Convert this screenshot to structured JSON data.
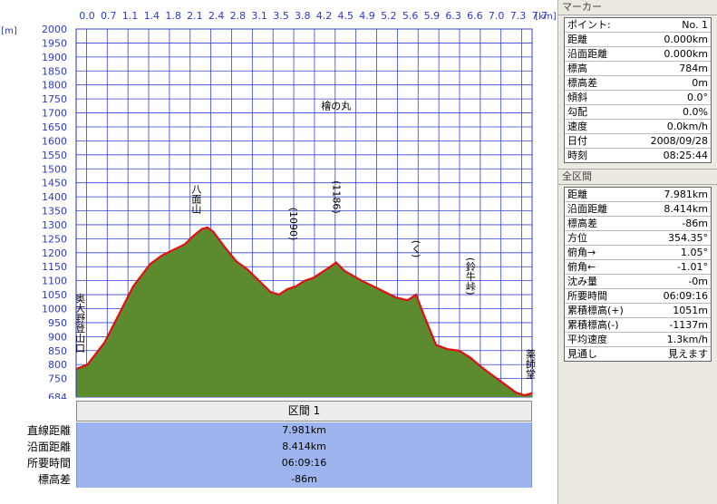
{
  "chart_data": {
    "type": "area",
    "title": "",
    "xlabel": "[km]",
    "ylabel": "[m]",
    "xlim": [
      0,
      7.981
    ],
    "ylim": [
      684,
      2000
    ],
    "x_ticks": [
      "0.0",
      "0.7",
      "1.1",
      "1.4",
      "1.8",
      "2.1",
      "2.4",
      "2.8",
      "3.1",
      "3.5",
      "3.8",
      "4.2",
      "4.5",
      "4.9",
      "5.2",
      "5.6",
      "5.9",
      "6.3",
      "6.6",
      "7.0",
      "7.3",
      "7.7"
    ],
    "y_ticks": [
      "2000",
      "1950",
      "1900",
      "1850",
      "1800",
      "1750",
      "1700",
      "1650",
      "1600",
      "1550",
      "1500",
      "1450",
      "1400",
      "1350",
      "1300",
      "1250",
      "1200",
      "1150",
      "1100",
      "1050",
      "1000",
      "950",
      "900",
      "850",
      "800",
      "750",
      "684"
    ],
    "x": [
      0,
      0.2,
      0.5,
      0.8,
      1.0,
      1.3,
      1.5,
      1.7,
      1.9,
      2.05,
      2.2,
      2.3,
      2.4,
      2.6,
      2.8,
      3.0,
      3.2,
      3.4,
      3.55,
      3.7,
      3.85,
      4.0,
      4.15,
      4.3,
      4.45,
      4.55,
      4.7,
      5.0,
      5.3,
      5.6,
      5.8,
      5.95,
      6.1,
      6.3,
      6.5,
      6.7,
      6.9,
      7.1,
      7.3,
      7.5,
      7.7,
      7.85,
      7.981
    ],
    "y": [
      784,
      800,
      880,
      1000,
      1080,
      1160,
      1190,
      1210,
      1230,
      1260,
      1285,
      1290,
      1275,
      1220,
      1170,
      1140,
      1100,
      1060,
      1050,
      1070,
      1080,
      1100,
      1110,
      1130,
      1150,
      1165,
      1135,
      1100,
      1070,
      1040,
      1030,
      1050,
      970,
      870,
      855,
      850,
      825,
      790,
      760,
      730,
      700,
      690,
      698
    ],
    "annotations": [
      {
        "text": "奥大野登山口",
        "x": 0.0,
        "y": 784
      },
      {
        "text": "八面山",
        "x": 2.1,
        "y": 1290
      },
      {
        "text": "(1090)",
        "x": 3.8,
        "y": 1090
      },
      {
        "text": "(1186)",
        "x": 4.55,
        "y": 1186
      },
      {
        "text": "檜の丸",
        "x": 4.55,
        "y": 1340
      },
      {
        "text": "(く)",
        "x": 5.95,
        "y": 1090
      },
      {
        "text": "(鈴牛峠)",
        "x": 6.9,
        "y": 950
      },
      {
        "text": "薬師堂",
        "x": 7.981,
        "y": 700
      }
    ]
  },
  "section": {
    "header": "区間 1",
    "rows": [
      {
        "label": "直線距離",
        "value": "7.981km"
      },
      {
        "label": "沿面距離",
        "value": "8.414km"
      },
      {
        "label": "所要時間",
        "value": "06:09:16"
      },
      {
        "label": "標高差",
        "value": "-86m"
      }
    ]
  },
  "marker_panel": {
    "title": "マーカー",
    "rows": [
      {
        "label": "ポイント:",
        "value": "No. 1"
      },
      {
        "label": "距離",
        "value": "0.000km"
      },
      {
        "label": "沿面距離",
        "value": "0.000km"
      },
      {
        "label": "標高",
        "value": "784m"
      },
      {
        "label": "標高差",
        "value": "0m"
      },
      {
        "label": "傾斜",
        "value": "0.0°"
      },
      {
        "label": "勾配",
        "value": "0.0%"
      },
      {
        "label": "速度",
        "value": "0.0km/h"
      },
      {
        "label": "日付",
        "value": "2008/09/28"
      },
      {
        "label": "時刻",
        "value": "08:25:44"
      }
    ]
  },
  "range_panel": {
    "title": "全区間",
    "rows": [
      {
        "label": "距離",
        "value": "7.981km"
      },
      {
        "label": "沿面距離",
        "value": "8.414km"
      },
      {
        "label": "標高差",
        "value": "-86m"
      },
      {
        "label": "方位",
        "value": "354.35°"
      },
      {
        "label": "俯角→",
        "value": "1.05°"
      },
      {
        "label": "俯角←",
        "value": "-1.01°"
      },
      {
        "label": "沈み量",
        "value": "-0m"
      },
      {
        "label": "所要時間",
        "value": "06:09:16"
      },
      {
        "label": "累積標高(+)",
        "value": "1051m"
      },
      {
        "label": "累積標高(-)",
        "value": "-1137m"
      },
      {
        "label": "平均速度",
        "value": "1.3km/h"
      },
      {
        "label": "見通し",
        "value": "見えます"
      }
    ]
  },
  "colors": {
    "fill": "#5c8a2e",
    "line": "#e01010",
    "grid": "#3340d8",
    "axis_text": "#2a39d0"
  }
}
